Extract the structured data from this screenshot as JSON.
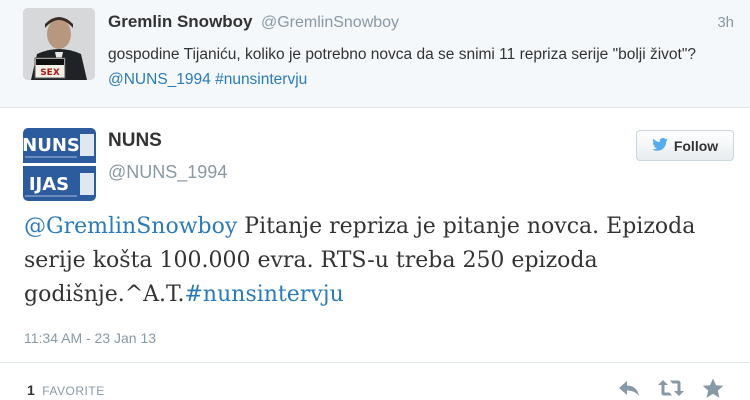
{
  "reply": {
    "name": "Gremlin Snowboy",
    "handle": "@GremlinSnowboy",
    "time": "3h",
    "text_before": "gospodine Tijaniću, koliko je potrebno novca da se snimi 11 repriza serije \"bolji život\"? ",
    "mention": "@NUNS_1994",
    "hashtag": "#nunsintervju",
    "avatar_sign": "SEX"
  },
  "tweet": {
    "name": "NUNS",
    "handle": "@NUNS_1994",
    "mention": "@GremlinSnowboy",
    "text": " Pitanje repriza je pitanje novca. Epizoda serije košta 100.000 evra. RTS-u treba 250 epizoda godišnje.^A.T.",
    "hashtag": "#nunsintervju",
    "timestamp": "11:34 AM - 23 Jan 13",
    "follow_label": "Follow",
    "favorites_count": "1",
    "favorites_label": "FAVORITE",
    "avatar_logo_top": "NUNS",
    "avatar_logo_bottom": "IJAS"
  },
  "colors": {
    "link": "#2b7bb9",
    "twitter_bird": "#55acee",
    "nuns_blue": "#2d5c9e"
  },
  "icons": [
    "reply-icon",
    "retweet-icon",
    "favorite-star-icon",
    "twitter-bird-icon"
  ]
}
